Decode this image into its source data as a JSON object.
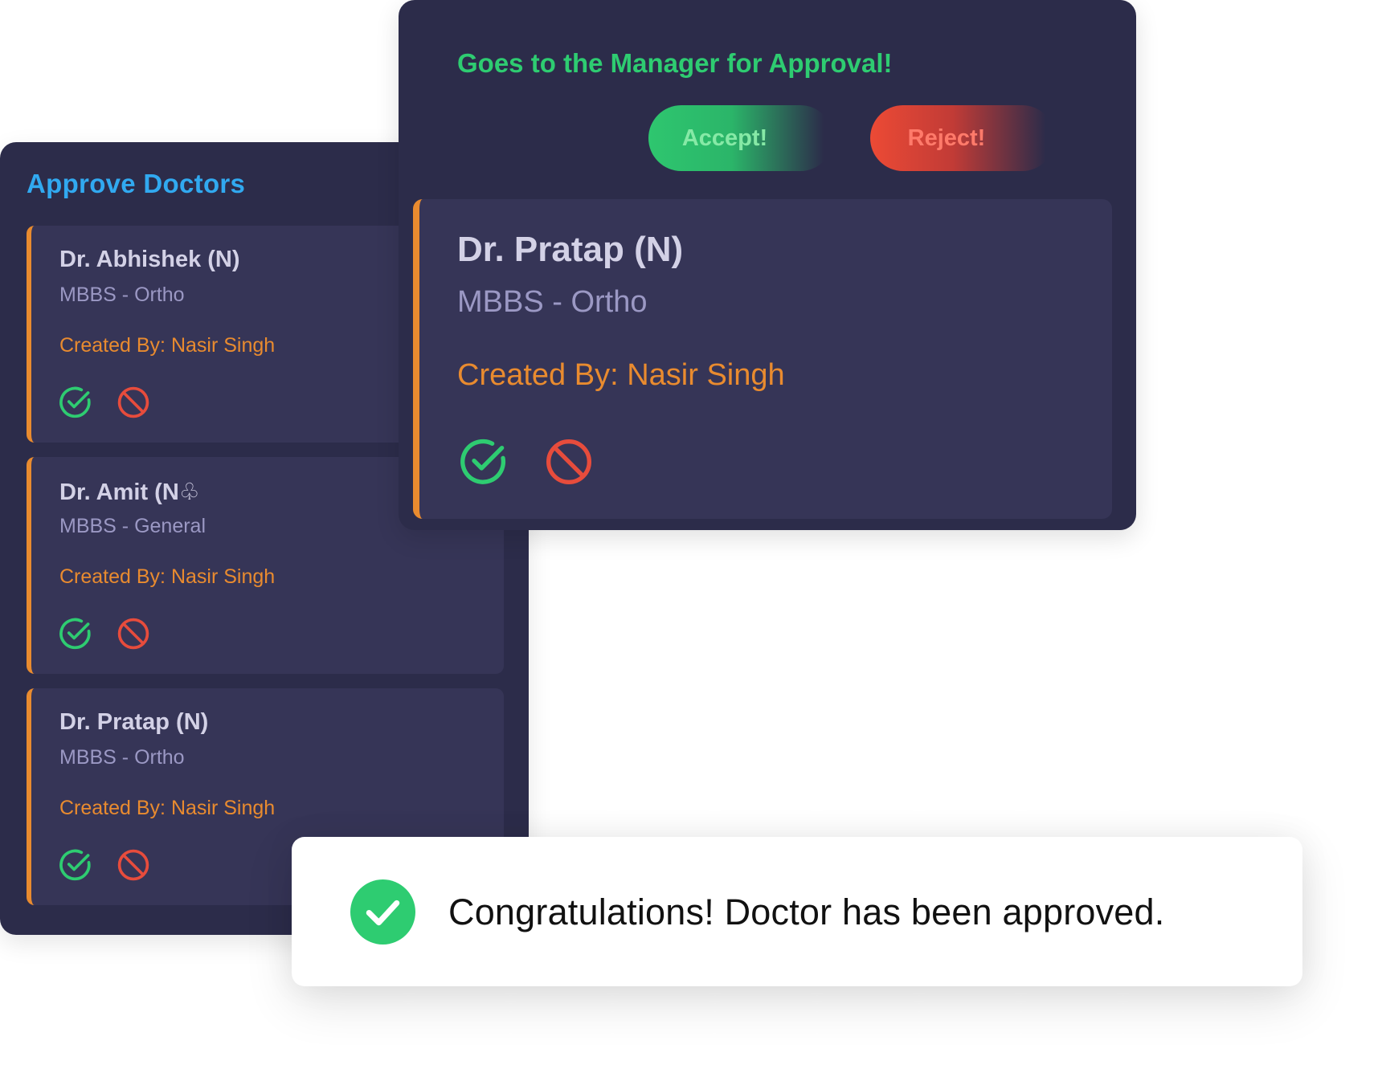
{
  "colors": {
    "panel_bg": "#2c2c4a",
    "card_bg": "#363557",
    "accent_orange": "#e98b2f",
    "title_blue": "#31a9f0",
    "success_green": "#2ecc71",
    "danger_red": "#e74c3c",
    "name_text": "#d3d1e6",
    "spec_text": "#9b98c4"
  },
  "left_panel": {
    "title": "Approve Doctors",
    "doctors": [
      {
        "name": "Dr. Abhishek (N)",
        "specialty": "MBBS - Ortho",
        "created_by": "Created By: Nasir Singh",
        "approve_icon": "check-circle-icon",
        "reject_icon": "block-icon"
      },
      {
        "name": "Dr. Amit (N♧",
        "specialty": "MBBS - General",
        "created_by": "Created By: Nasir Singh",
        "approve_icon": "check-circle-icon",
        "reject_icon": "block-icon"
      },
      {
        "name": "Dr. Pratap (N)",
        "specialty": "MBBS - Ortho",
        "created_by": "Created By: Nasir Singh",
        "approve_icon": "check-circle-icon",
        "reject_icon": "block-icon"
      }
    ]
  },
  "approval_panel": {
    "heading": "Goes to the Manager for Approval!",
    "accept_label": "Accept!",
    "reject_label": "Reject!",
    "selected_doctor": {
      "name": "Dr. Pratap (N)",
      "specialty": "MBBS - Ortho",
      "created_by": "Created By: Nasir Singh"
    }
  },
  "toast": {
    "icon": "check-circle-filled-icon",
    "message": "Congratulations! Doctor has been approved."
  }
}
